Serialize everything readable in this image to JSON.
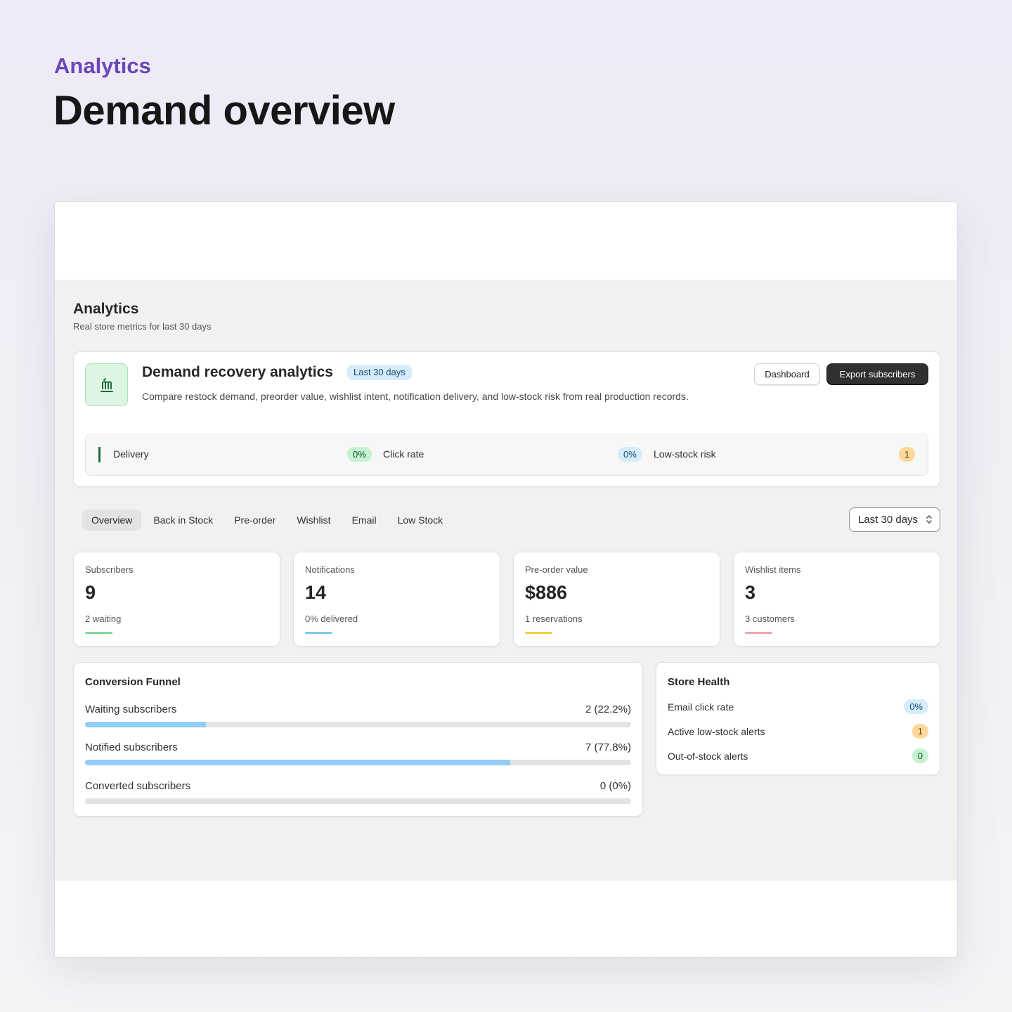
{
  "hero": {
    "eyebrow": "Analytics",
    "title": "Demand overview"
  },
  "page": {
    "title": "Analytics",
    "subtitle": "Real store metrics for last 30 days"
  },
  "summary_card": {
    "title": "Demand recovery analytics",
    "badge": "Last 30 days",
    "description": "Compare restock demand, preorder value, wishlist intent, notification delivery, and low-stock risk from real production records.",
    "dashboard_label": "Dashboard",
    "export_label": "Export subscribers",
    "icon": "analytics-icon",
    "metrics": [
      {
        "label": "Delivery",
        "value": "0%",
        "tone": "green"
      },
      {
        "label": "Click rate",
        "value": "0%",
        "tone": "blue"
      },
      {
        "label": "Low-stock risk",
        "value": "1",
        "tone": "orange"
      }
    ]
  },
  "tabs": [
    "Overview",
    "Back in Stock",
    "Pre-order",
    "Wishlist",
    "Email",
    "Low Stock"
  ],
  "active_tab": "Overview",
  "range_select": {
    "value": "Last 30 days"
  },
  "stats": [
    {
      "label": "Subscribers",
      "value": "9",
      "sub": "2 waiting",
      "color": "#7fdc9b"
    },
    {
      "label": "Notifications",
      "value": "14",
      "sub": "0% delivered",
      "color": "#7fc8ea"
    },
    {
      "label": "Pre-order value",
      "value": "$886",
      "sub": "1 reservations",
      "color": "#f2cf3f"
    },
    {
      "label": "Wishlist items",
      "value": "3",
      "sub": "3 customers",
      "color": "#f3a3b5"
    }
  ],
  "funnel": {
    "title": "Conversion Funnel",
    "rows": [
      {
        "label": "Waiting subscribers",
        "value": "2 (22.2%)",
        "fraction": 0.222
      },
      {
        "label": "Notified subscribers",
        "value": "7 (77.8%)",
        "fraction": 0.778
      },
      {
        "label": "Converted subscribers",
        "value": "0 (0%)",
        "fraction": 0
      }
    ]
  },
  "store_health": {
    "title": "Store Health",
    "rows": [
      {
        "label": "Email click rate",
        "value": "0%",
        "tone": "blue"
      },
      {
        "label": "Active low-stock alerts",
        "value": "1",
        "tone": "orange"
      },
      {
        "label": "Out-of-stock alerts",
        "value": "0",
        "tone": "green"
      }
    ]
  },
  "colors": {
    "accent": "#6b46b8",
    "funnel_fill": "#91cdf6",
    "primary_button": "#303030"
  }
}
